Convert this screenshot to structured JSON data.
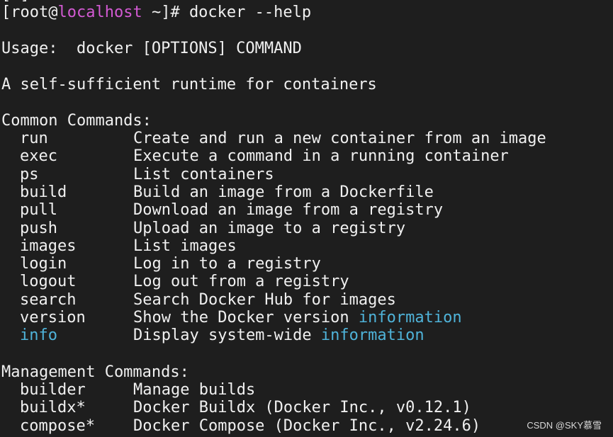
{
  "prompt": {
    "open_bracket": "[",
    "user": "root@",
    "host": "localhost",
    "path": " ~]# ",
    "command": "docker --help"
  },
  "usage": "Usage:  docker [OPTIONS] COMMAND",
  "tagline": "A self-sufficient runtime for containers",
  "common_header": "Common Commands:",
  "common_commands": [
    {
      "cmd": "run",
      "desc": "Create and run a new container from an image",
      "desc_hl": ""
    },
    {
      "cmd": "exec",
      "desc": "Execute a command in a running container",
      "desc_hl": ""
    },
    {
      "cmd": "ps",
      "desc": "List containers",
      "desc_hl": ""
    },
    {
      "cmd": "build",
      "desc": "Build an image from a Dockerfile",
      "desc_hl": ""
    },
    {
      "cmd": "pull",
      "desc": "Download an image from a registry",
      "desc_hl": ""
    },
    {
      "cmd": "push",
      "desc": "Upload an image to a registry",
      "desc_hl": ""
    },
    {
      "cmd": "images",
      "desc": "List images",
      "desc_hl": ""
    },
    {
      "cmd": "login",
      "desc": "Log in to a registry",
      "desc_hl": ""
    },
    {
      "cmd": "logout",
      "desc": "Log out from a registry",
      "desc_hl": ""
    },
    {
      "cmd": "search",
      "desc": "Search Docker Hub for images",
      "desc_hl": ""
    },
    {
      "cmd": "version",
      "desc": "Show the Docker version ",
      "desc_hl": "information"
    },
    {
      "cmd": "info",
      "desc": "Display system-wide ",
      "desc_hl": "information"
    }
  ],
  "management_header": "Management Commands:",
  "management_commands": [
    {
      "cmd": "builder",
      "desc": "Manage builds"
    },
    {
      "cmd": "buildx*",
      "desc": "Docker Buildx (Docker Inc., v0.12.1)"
    },
    {
      "cmd": "compose*",
      "desc": "Docker Compose (Docker Inc., v2.24.6)"
    }
  ],
  "watermark": "CSDN @SKY慕雪",
  "colors": {
    "background": "#1e1e1e",
    "text": "#f0f0f0",
    "host": "#d35ad3",
    "highlight": "#4fb3d9"
  }
}
